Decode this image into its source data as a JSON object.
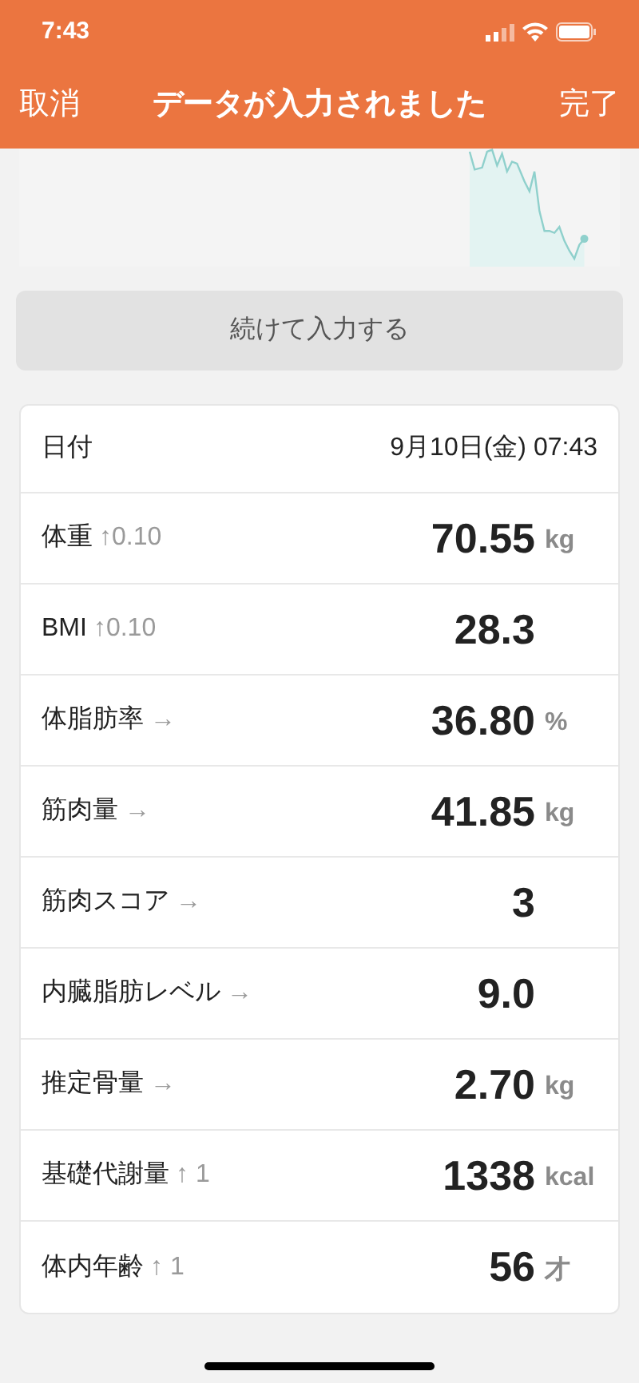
{
  "status_bar": {
    "time": "7:43"
  },
  "nav": {
    "cancel": "取消",
    "title": "データが入力されました",
    "done": "完了"
  },
  "continue_button": "続けて入力する",
  "date_row": {
    "label": "日付",
    "value": "9月10日(金) 07:43"
  },
  "measurements": [
    {
      "label": "体重",
      "trend": "↑0.10",
      "value": "70.55",
      "unit": "kg"
    },
    {
      "label": "BMI",
      "trend": "↑0.10",
      "value": "28.3"
    },
    {
      "label": "体脂肪率",
      "trend": "→",
      "value": "36.80",
      "unit": "%"
    },
    {
      "label": "筋肉量",
      "trend": "→",
      "value": "41.85",
      "unit": "kg"
    },
    {
      "label": "筋肉スコア",
      "trend": "→",
      "value": "3"
    },
    {
      "label": "内臓脂肪レベル",
      "trend": "→",
      "value": "9.0"
    },
    {
      "label": "推定骨量",
      "trend": "→",
      "value": "2.70",
      "unit": "kg"
    },
    {
      "label": "基礎代謝量",
      "trend": "↑ 1",
      "value": "1338",
      "unit": "kcal"
    },
    {
      "label": "体内年齢",
      "trend": "↑ 1",
      "value": "56",
      "unit": "才"
    }
  ]
}
